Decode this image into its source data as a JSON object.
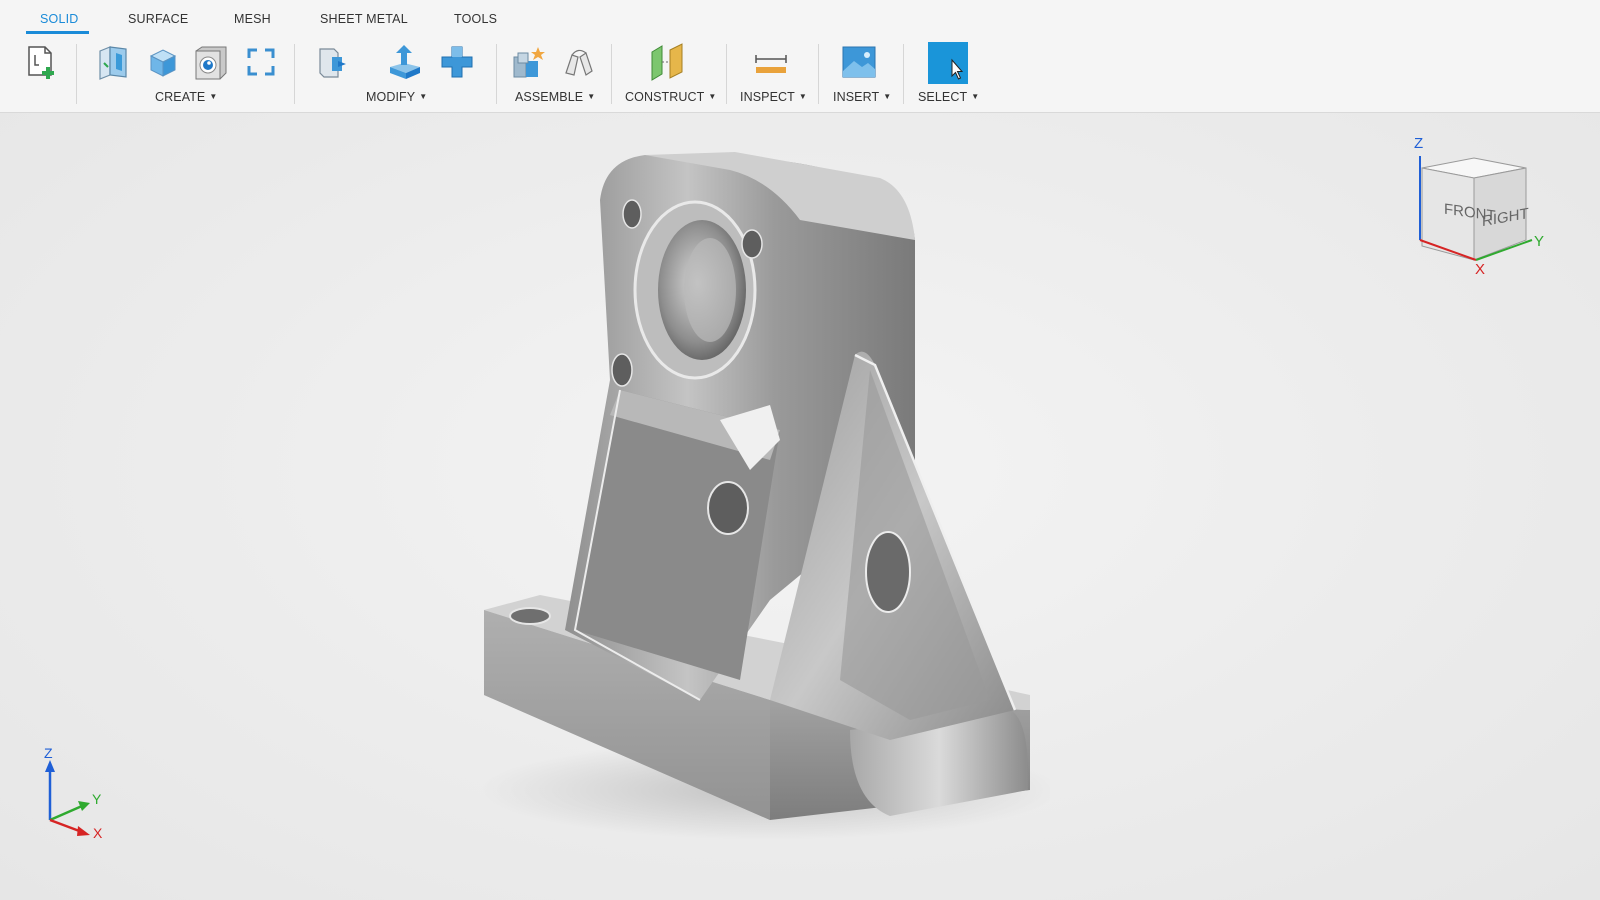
{
  "tabs": [
    {
      "label": "SOLID",
      "active": true
    },
    {
      "label": "SURFACE",
      "active": false
    },
    {
      "label": "MESH",
      "active": false
    },
    {
      "label": "SHEET METAL",
      "active": false
    },
    {
      "label": "TOOLS",
      "active": false
    }
  ],
  "groups": {
    "create": "CREATE",
    "modify": "MODIFY",
    "assemble": "ASSEMBLE",
    "construct": "CONSTRUCT",
    "inspect": "INSPECT",
    "insert": "INSERT",
    "select": "SELECT"
  },
  "tools": {
    "new_component": "new-component-icon",
    "create_sketch": "sketch-icon",
    "box": "box-icon",
    "shell": "shell-icon",
    "form": "form-icon",
    "press_pull": "press-pull-icon",
    "extrude": "extrude-icon",
    "combine": "combine-icon",
    "new_joint": "new-component-joint-icon",
    "joint": "joint-icon",
    "offset_plane": "offset-plane-icon",
    "measure": "measure-icon",
    "insert_image": "insert-image-icon",
    "select": "select-cursor-icon"
  },
  "navcube": {
    "front": "FRONT",
    "right": "RIGHT",
    "z": "Z",
    "y": "Y",
    "x": "X"
  },
  "triad": {
    "z": "Z",
    "y": "Y",
    "x": "X"
  },
  "colors": {
    "accent": "#1a8bd8",
    "select_button": "#1a95d9",
    "axis_z": "#1f5fd6",
    "axis_y": "#2faa2f",
    "axis_x": "#d62424"
  }
}
